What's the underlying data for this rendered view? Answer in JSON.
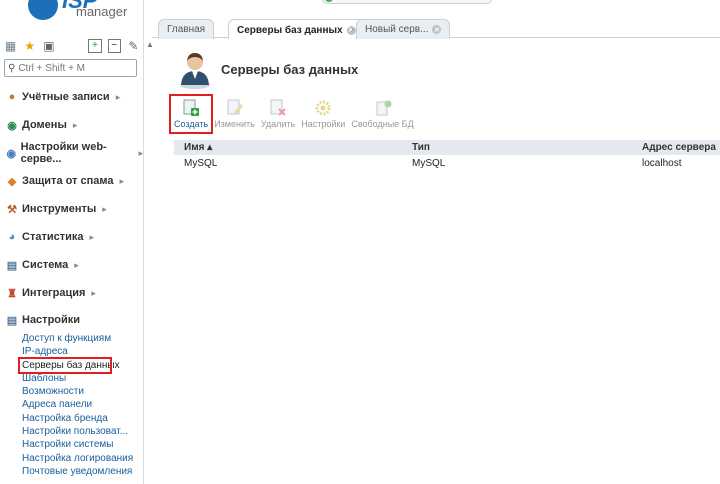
{
  "logo": {
    "brand": "ISP",
    "subtitle": "manager"
  },
  "sidebar": {
    "search_placeholder": "Ctrl + Shift + M",
    "items": [
      {
        "label": "Учётные записи",
        "icon": "users-icon"
      },
      {
        "label": "Домены",
        "icon": "globe-icon"
      },
      {
        "label": "Настройки web-серве...",
        "icon": "web-settings-icon"
      },
      {
        "label": "Защита от спама",
        "icon": "shield-icon"
      },
      {
        "label": "Инструменты",
        "icon": "tools-icon"
      },
      {
        "label": "Статистика",
        "icon": "pie-chart-icon"
      },
      {
        "label": "Система",
        "icon": "system-icon"
      },
      {
        "label": "Интеграция",
        "icon": "integration-icon"
      },
      {
        "label": "Настройки",
        "icon": "settings-icon"
      }
    ],
    "sub_items": [
      "Доступ к функциям",
      "IP-адреса",
      "Серверы баз данных",
      "Шаблоны",
      "Возможности",
      "Адреса панели",
      "Настройка бренда",
      "Настройки пользоват...",
      "Настройки системы",
      "Настройка логирования",
      "Почтовые уведомления"
    ]
  },
  "tabs": {
    "home": "Главная",
    "active": "Серверы баз данных",
    "next": "Новый серв..."
  },
  "page": {
    "title": "Серверы баз данных"
  },
  "toolbar": {
    "create": "Создать",
    "edit": "Изменить",
    "delete": "Удалить",
    "settings": "Настройки",
    "free_db": "Свободные БД"
  },
  "table": {
    "headers": {
      "name": "Имя ▴",
      "type": "Тип",
      "address": "Адрес сервера"
    },
    "rows": [
      {
        "name": "MySQL",
        "type": "MySQL",
        "address": "localhost"
      }
    ]
  },
  "colors": {
    "accent": "#1a5f9a",
    "highlight": "#e02020"
  }
}
